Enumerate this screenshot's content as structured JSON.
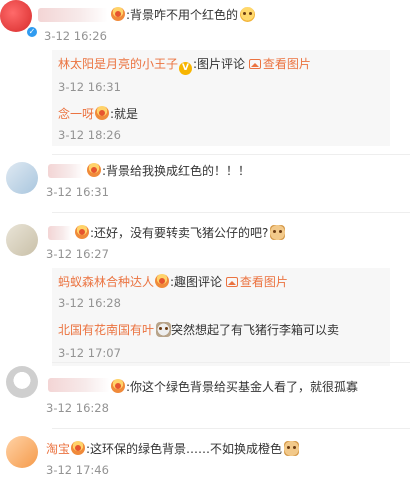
{
  "comments": [
    {
      "text": ":背景咋不用个红色的",
      "time": "3-12 16:26",
      "replies": [
        {
          "name": "林太阳是月亮的小王子",
          "text": ":图片评论",
          "link": "查看图片",
          "time": "3-12 16:31"
        },
        {
          "name": "念一呀",
          "text": ":就是",
          "time": "3-12 18:26"
        }
      ]
    },
    {
      "text": ":背景给我换成红色的！！！",
      "time": "3-12 16:31"
    },
    {
      "text": ":还好，没有要转卖飞猪公仔的吧?",
      "time": "3-12 16:27",
      "replies": [
        {
          "name": "蚂蚁森林合种达人",
          "text": ":趣图评论",
          "link": "查看图片",
          "time": "3-12 16:28"
        },
        {
          "name": "北国有花南国有叶",
          "text": "突然想起了有飞猪行李箱可以卖",
          "time": "3-12 17:07"
        }
      ]
    },
    {
      "text": ":你这个绿色背景给买基金人看了，就很孤寡",
      "time": "3-12 16:28"
    },
    {
      "name": "淘宝",
      "text": ":这环保的绿色背景……不如换成橙色",
      "time": "3-12 17:46"
    }
  ],
  "icons": [
    "verified-badge-icon",
    "fan-medal-icon",
    "image-icon",
    "emoji-icon"
  ],
  "colors": {
    "name": "#eb7340",
    "time": "#939393",
    "reply_bg": "#f7f7f7",
    "verified": "#2f9bf0"
  }
}
